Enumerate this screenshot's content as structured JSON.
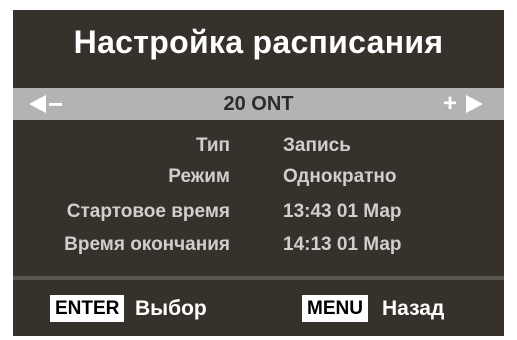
{
  "screen": {
    "title": "Настройка расписания"
  },
  "channel": {
    "name": "20 ONT",
    "prev_symbol": "−",
    "next_symbol": "+"
  },
  "fields": [
    {
      "label": "Тип",
      "value": "Запись"
    },
    {
      "label": "Режим",
      "value": "Однократно"
    },
    {
      "label": "Стартовое время",
      "value": "13:43  01  Мар"
    },
    {
      "label": "Время окончания",
      "value": "14:13  01  Мар"
    }
  ],
  "footer": {
    "enter_key": "ENTER",
    "enter_action": "Выбор",
    "menu_key": "MENU",
    "menu_action": "Назад"
  },
  "colors": {
    "panel_bg": "#37312b",
    "channel_bar_bg": "#b3b3b3",
    "text": "#ffffff"
  }
}
